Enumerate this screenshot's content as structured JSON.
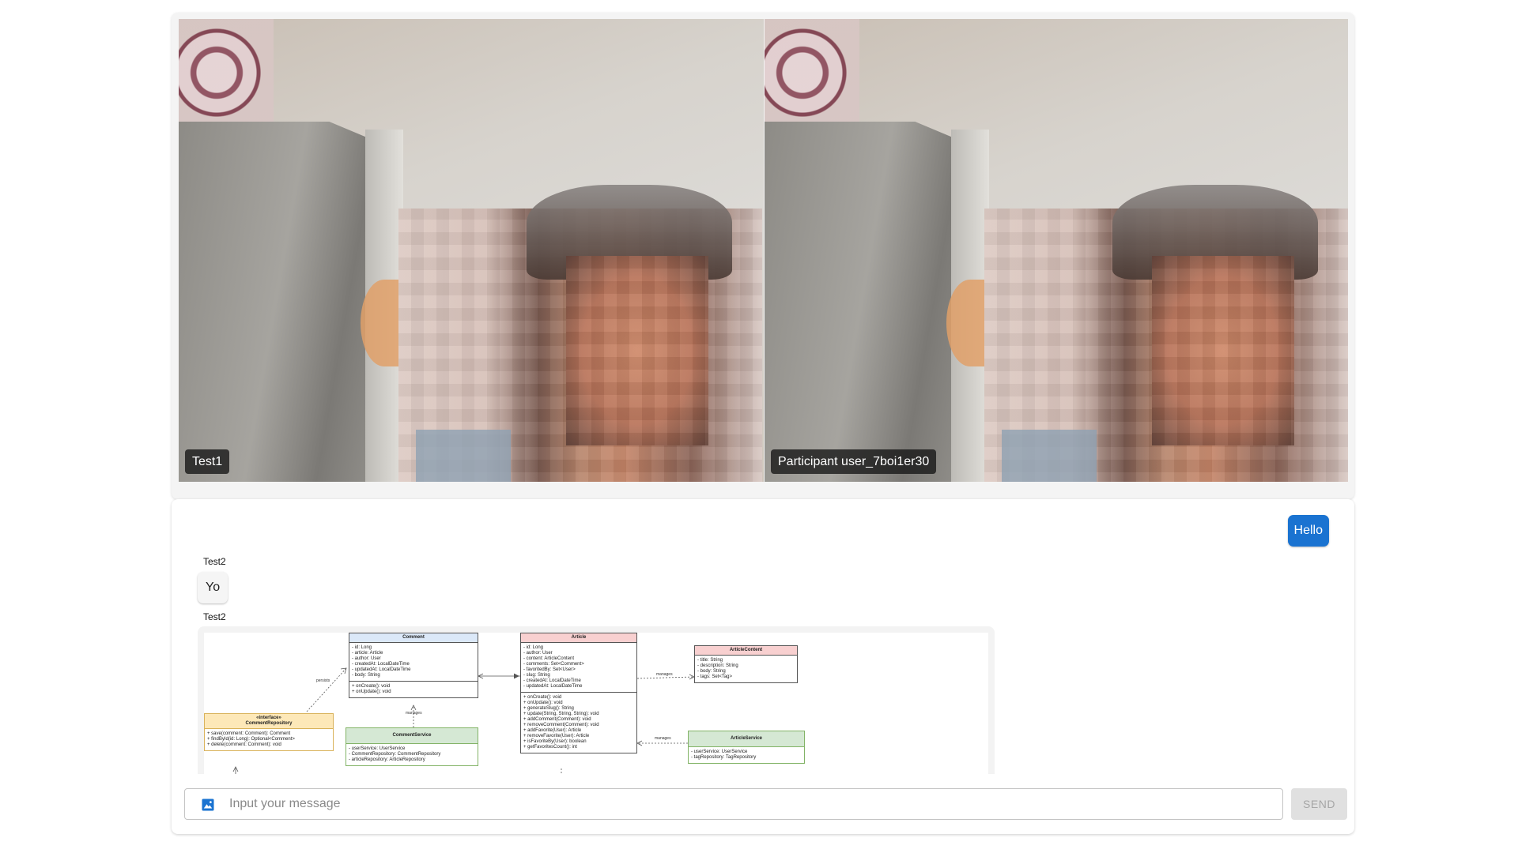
{
  "videos": [
    {
      "name": "Test1"
    },
    {
      "name": "Participant user_7boi1er30"
    }
  ],
  "chat": {
    "messages": [
      {
        "sender": "",
        "text": "Hello",
        "mine": true
      },
      {
        "sender": "Test2",
        "text": "Yo",
        "mine": false
      },
      {
        "sender": "Test2",
        "type": "image",
        "mine": false
      }
    ],
    "diagram": {
      "comment": {
        "title": "Comment",
        "fields": "- id: Long\n- article: Article\n- author: User\n- createdAt: LocalDateTime\n- updatedAt: LocalDateTime\n- body: String",
        "methods": "+ onCreate(): void\n+ onUpdate(): void"
      },
      "article": {
        "title": "Article",
        "fields": "- id: Long\n- author: User\n- content: ArticleContent\n- comments: Set<Comment>\n- favoritedBy: Set<User>\n- slug: String\n- createdAt: LocalDateTime\n- updatedAt: LocalDateTime",
        "methods": "+ onCreate(): void\n+ onUpdate(): void\n+ generateSlug(): String\n+ update(String, String, String): void\n+ addComment(Comment): void\n+ removeComment(Comment): void\n+ addFavorite(User): Article\n+ removeFavorite(User): Article\n+ isFavoriteBy(User): boolean\n+ getFavoritesCount(): int"
      },
      "article_content": {
        "title": "ArticleContent",
        "fields": "- title: String\n- description: String\n- body: String\n- tags: Set<Tag>"
      },
      "comment_repository": {
        "title": "«interface»\nCommentRepository",
        "methods": "+ save(comment: Comment): Comment\n+ findById(id: Long): Optional<Comment>\n+ delete(comment: Comment): void"
      },
      "comment_service": {
        "title": "CommentService",
        "fields": "- userService: UserService\n- CommentRepository: CommentRepository\n- articleRepository: ArticleRepository"
      },
      "article_service": {
        "title": "ArticleService",
        "fields": "- userService: UserService\n- tagRepository: TagRepository"
      },
      "labels": {
        "persists": "persists",
        "manages1": "manages",
        "manages2": "manages",
        "manages3": "manages"
      }
    },
    "input": {
      "placeholder": "Input your message",
      "value": ""
    },
    "send_label": "SEND",
    "colors": {
      "accent": "#1a73d1",
      "comment_header": "#dbe8f8",
      "article_header": "#f8d0d0",
      "repository_header": "#fde8b8",
      "service_header": "#d5e8d4"
    }
  }
}
